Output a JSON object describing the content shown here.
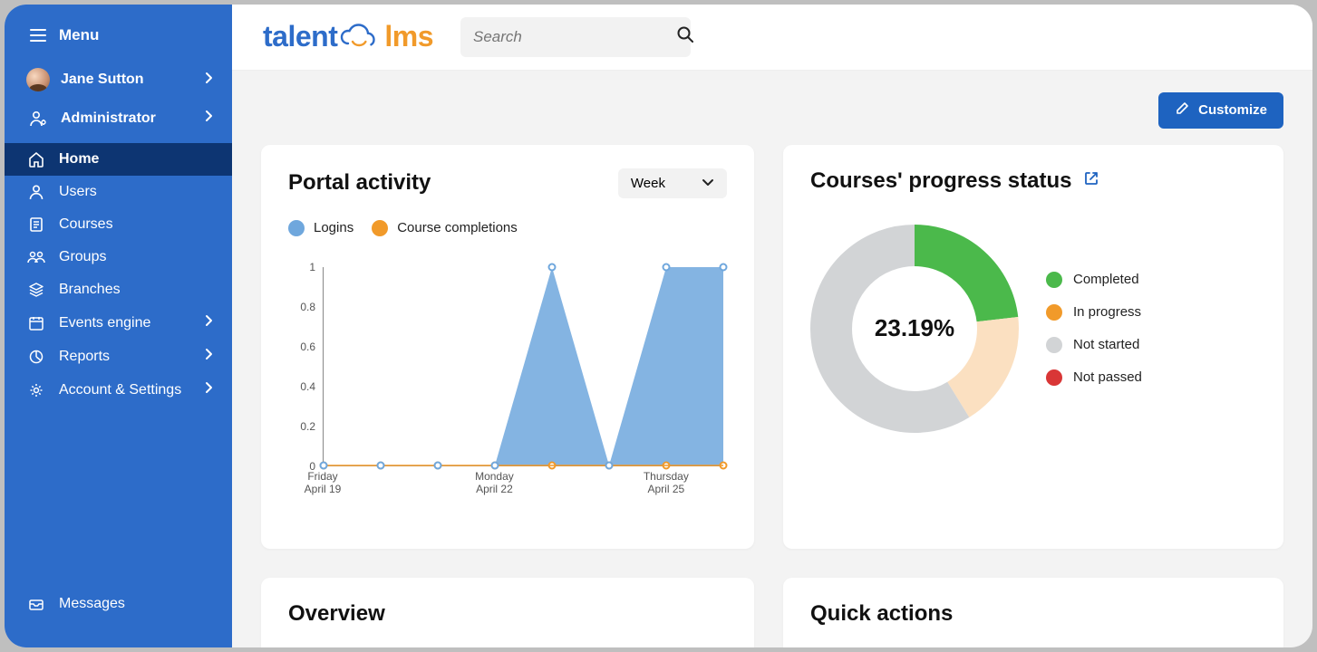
{
  "brand": {
    "part1": "talent",
    "part2": "lms"
  },
  "sidebar": {
    "menu_label": "Menu",
    "user_name": "Jane Sutton",
    "role_label": "Administrator",
    "items": [
      {
        "label": "Home"
      },
      {
        "label": "Users"
      },
      {
        "label": "Courses"
      },
      {
        "label": "Groups"
      },
      {
        "label": "Branches"
      },
      {
        "label": "Events engine"
      },
      {
        "label": "Reports"
      },
      {
        "label": "Account & Settings"
      }
    ],
    "messages_label": "Messages"
  },
  "search": {
    "placeholder": "Search"
  },
  "customize_label": "Customize",
  "portal_activity": {
    "title": "Portal activity",
    "period": "Week",
    "legend": {
      "logins": "Logins",
      "completions": "Course completions"
    }
  },
  "progress_card": {
    "title": "Courses' progress status",
    "center": "23.19%",
    "legend": {
      "completed": "Completed",
      "in_progress": "In progress",
      "not_started": "Not started",
      "not_passed": "Not passed"
    }
  },
  "overview_title": "Overview",
  "quick_actions_title": "Quick actions",
  "colors": {
    "blue": "#6fa7dd",
    "orange": "#f19a2a",
    "green": "#4bb94b",
    "peach": "#fbe0c1",
    "grey": "#d2d4d6",
    "red": "#d93636"
  },
  "chart_data": [
    {
      "type": "area",
      "title": "Portal activity",
      "xlabel": "",
      "ylabel": "",
      "ylim": [
        0,
        1
      ],
      "x": [
        "Fri Apr 19",
        "Sat Apr 20",
        "Sun Apr 21",
        "Mon Apr 22",
        "Tue Apr 23",
        "Wed Apr 24",
        "Thu Apr 25",
        "Fri Apr 26"
      ],
      "x_tick_labels": [
        {
          "index": 0,
          "line1": "Friday",
          "line2": "April 19"
        },
        {
          "index": 3,
          "line1": "Monday",
          "line2": "April 22"
        },
        {
          "index": 6,
          "line1": "Thursday",
          "line2": "April 25"
        }
      ],
      "y_ticks": [
        0,
        0.2,
        0.4,
        0.6,
        0.8,
        1
      ],
      "series": [
        {
          "name": "Logins",
          "color": "#6fa7dd",
          "values": [
            0,
            0,
            0,
            0,
            1,
            0,
            1,
            1
          ]
        },
        {
          "name": "Course completions",
          "color": "#f19a2a",
          "values": [
            0,
            0,
            0,
            0,
            0,
            0,
            0,
            0
          ]
        }
      ]
    },
    {
      "type": "pie",
      "title": "Courses' progress status",
      "center_label": "23.19%",
      "series": [
        {
          "name": "Completed",
          "color": "#4bb94b",
          "value": 23.19
        },
        {
          "name": "In progress",
          "color": "#fbe0c1",
          "value": 18
        },
        {
          "name": "Not started",
          "color": "#d2d4d6",
          "value": 58.81
        },
        {
          "name": "Not passed",
          "color": "#d93636",
          "value": 0
        }
      ]
    }
  ]
}
